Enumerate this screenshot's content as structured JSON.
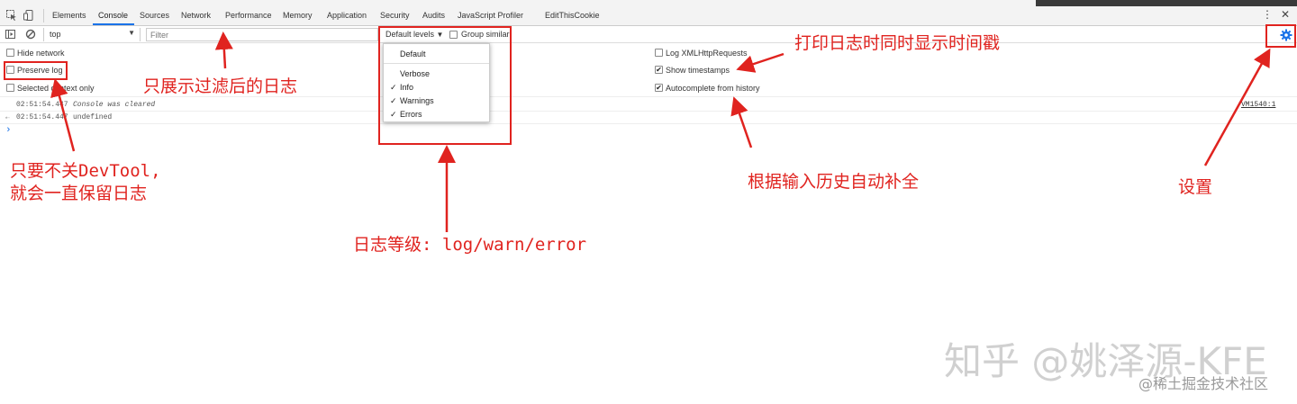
{
  "tabs": [
    "Elements",
    "Console",
    "Sources",
    "Network",
    "Performance",
    "Memory",
    "Application",
    "Security",
    "Audits",
    "JavaScript Profiler",
    "EditThisCookie"
  ],
  "toolbar": {
    "context": "top",
    "filter_placeholder": "Filter",
    "levels_label": "Default levels",
    "group_similar": "Group similar"
  },
  "settings": {
    "hide_network": "Hide network",
    "preserve_log": "Preserve log",
    "selected_context_only": "Selected context only",
    "log_xhr": "Log XMLHttpRequests",
    "show_timestamps": "Show timestamps",
    "autocomplete": "Autocomplete from history",
    "show_timestamps_checked": true,
    "autocomplete_checked": true
  },
  "levels_menu": {
    "default": "Default",
    "verbose": "Verbose",
    "info": "Info",
    "warnings": "Warnings",
    "errors": "Errors"
  },
  "console": {
    "line1_time": "02:51:54.447",
    "line1_text": "Console was cleared",
    "line1_source": "VM1540:1",
    "line2_time": "02:51:54.447",
    "line2_text": "undefined",
    "prompt": "›"
  },
  "annotations": {
    "filter_note": "只展示过滤后的日志",
    "preserve_note_1": "只要不关DevTool,",
    "preserve_note_2": "就会一直保留日志",
    "levels_note": "日志等级: log/warn/error",
    "timestamp_note": "打印日志时同时显示时间戳",
    "autocomplete_note": "根据输入历史自动补全",
    "settings_note": "设置"
  },
  "watermark": {
    "main": "知乎 @姚泽源-KFE",
    "sub": "@稀土掘金技术社区"
  },
  "colors": {
    "annotation_red": "#e0231f",
    "active_tab_underline": "#1a73e8",
    "gear_blue": "#1a73e8"
  }
}
